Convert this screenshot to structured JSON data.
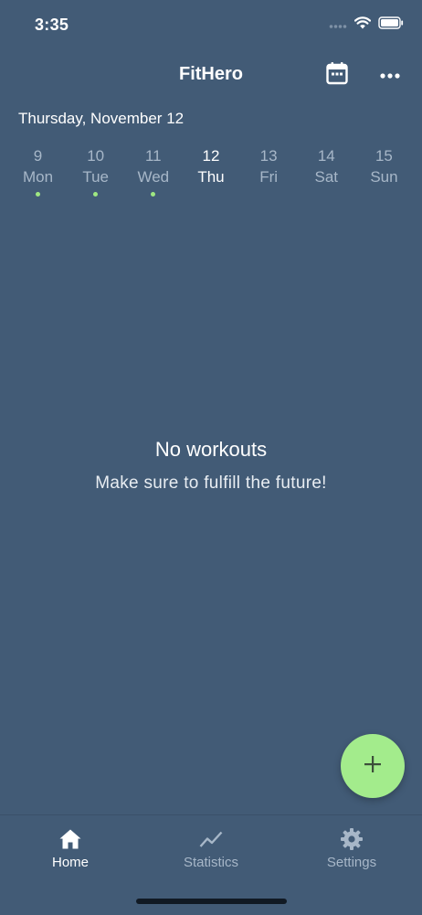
{
  "status_bar": {
    "time": "3:35",
    "icons": [
      "cellular-icon",
      "wifi-icon",
      "battery-icon"
    ]
  },
  "header": {
    "title": "FitHero",
    "actions": [
      "calendar-icon",
      "more-icon"
    ]
  },
  "selected_date": "Thursday, November 12",
  "week": [
    {
      "num": "9",
      "name": "Mon",
      "has_workout": true,
      "selected": false
    },
    {
      "num": "10",
      "name": "Tue",
      "has_workout": true,
      "selected": false
    },
    {
      "num": "11",
      "name": "Wed",
      "has_workout": true,
      "selected": false
    },
    {
      "num": "12",
      "name": "Thu",
      "has_workout": false,
      "selected": true
    },
    {
      "num": "13",
      "name": "Fri",
      "has_workout": false,
      "selected": false
    },
    {
      "num": "14",
      "name": "Sat",
      "has_workout": false,
      "selected": false
    },
    {
      "num": "15",
      "name": "Sun",
      "has_workout": false,
      "selected": false
    }
  ],
  "empty_state": {
    "title": "No workouts",
    "subtitle": "Make sure to fulfill the future!"
  },
  "fab": {
    "icon": "plus-icon"
  },
  "tabs": [
    {
      "label": "Home",
      "icon": "home-icon",
      "active": true
    },
    {
      "label": "Statistics",
      "icon": "chart-icon",
      "active": false
    },
    {
      "label": "Settings",
      "icon": "gear-icon",
      "active": false
    }
  ],
  "colors": {
    "background": "#425b76",
    "accent": "#a3ec8c",
    "inactive_text": "#a7b7c8"
  }
}
